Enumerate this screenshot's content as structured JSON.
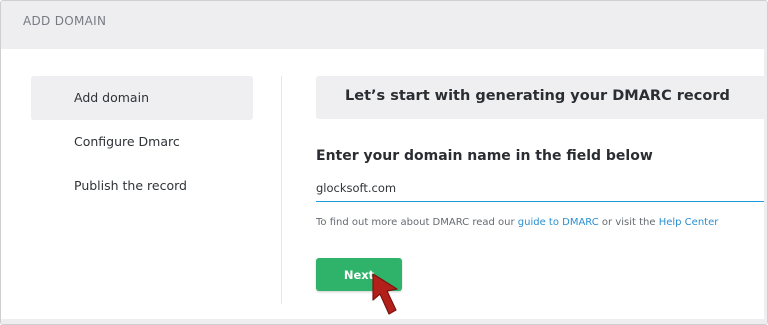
{
  "header": {
    "title": "ADD DOMAIN"
  },
  "sidebar": {
    "items": [
      {
        "label": "Add domain",
        "active": true
      },
      {
        "label": "Configure Dmarc",
        "active": false
      },
      {
        "label": "Publish the record",
        "active": false
      }
    ]
  },
  "main": {
    "banner": "Let’s start with generating your DMARC record",
    "field_label": "Enter your domain name in the field below",
    "domain_value": "glocksoft.com",
    "hint": {
      "prefix": "To find out more about DMARC read our ",
      "guide_link": "guide to DMARC",
      "middle": " or visit the ",
      "help_link": "Help Center"
    },
    "next_label": "Next"
  },
  "colors": {
    "accent_green": "#2fb36a",
    "link_blue": "#2a8fd0",
    "input_underline": "#1c9bd8",
    "annotation_arrow": "#b3201a"
  },
  "icons": {
    "annotation": "red-arrow-pointer"
  }
}
